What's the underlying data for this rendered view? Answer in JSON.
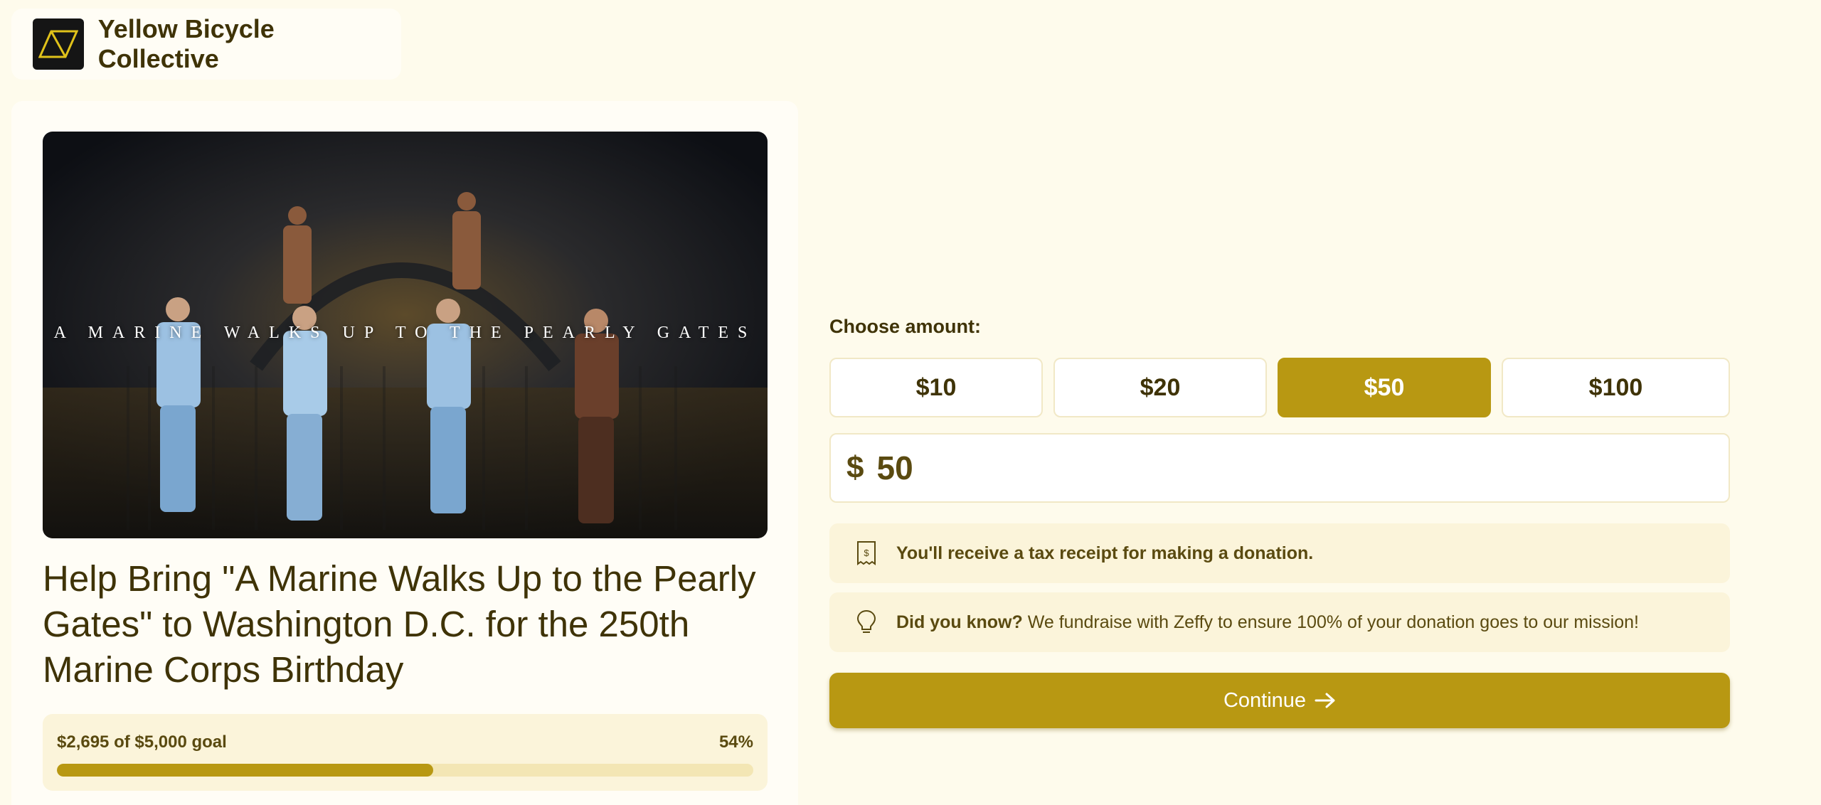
{
  "org": {
    "name": "Yellow Bicycle Collective",
    "logo_icon": "yellow-triangle-logo"
  },
  "campaign": {
    "hero_caption": "A MARINE WALKS UP TO THE PEARLY GATES",
    "title": "Help Bring \"A Marine Walks Up to the Pearly Gates\" to Washington D.C. for the 250th Marine Corps Birthday",
    "progress": {
      "label": "$2,695 of $5,000 goal",
      "percent_text": "54%",
      "fraction": 0.54
    }
  },
  "form": {
    "choose_label": "Choose amount:",
    "amounts": [
      "$10",
      "$20",
      "$50",
      "$100"
    ],
    "selected_amount": "$50",
    "currency_symbol": "$",
    "amount_value": "50",
    "tax_receipt_text": "You'll receive a tax receipt for making a donation.",
    "did_you_know_bold": "Did you know?",
    "did_you_know_text": " We fundraise with Zeffy to ensure 100% of your donation goes to our mission!",
    "continue_label": "Continue"
  },
  "colors": {
    "accent": "#b89812",
    "background": "#fefbec",
    "text": "#3f3307"
  }
}
